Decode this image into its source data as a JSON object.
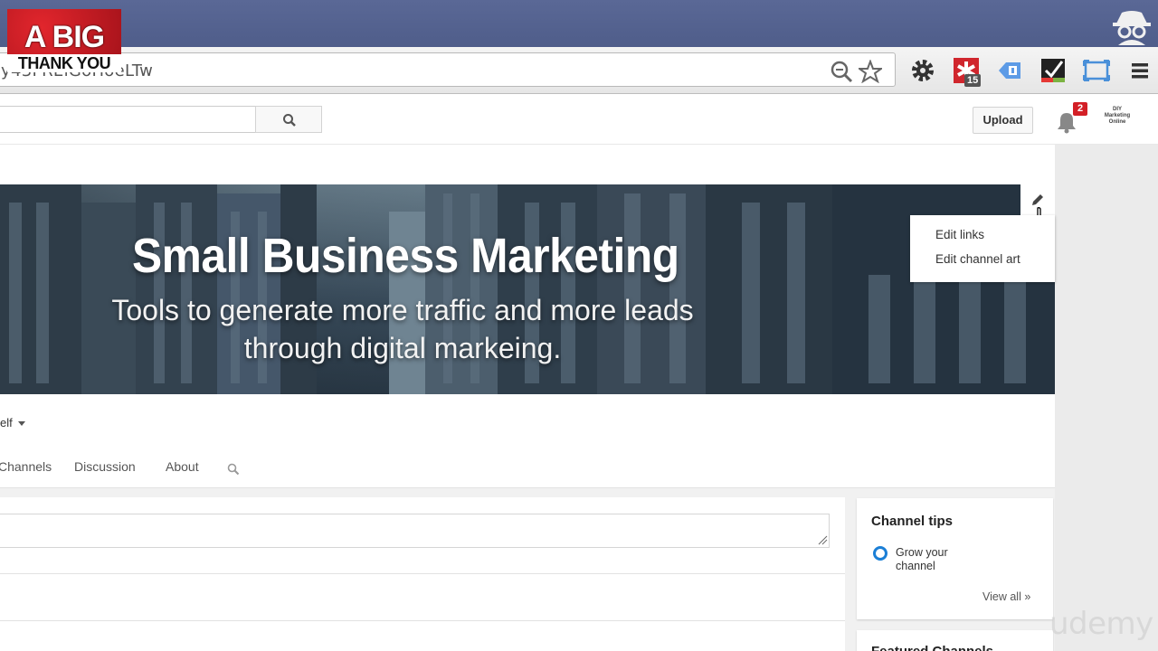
{
  "browser": {
    "url_fragment": "y43FRElGoHoeLTw",
    "extension_badge": "15"
  },
  "overlay": {
    "line1": "A BIG",
    "line2": "THANK YOU"
  },
  "masthead": {
    "search_placeholder": "",
    "upload_label": "Upload",
    "notification_count": "2",
    "avatar_text": "DIY Marketing Online"
  },
  "banner": {
    "title": "Small Business Marketing",
    "subtitle": "Tools to generate more traffic and more leads through digital markeing."
  },
  "edit_menu": {
    "items": [
      "Edit links",
      "Edit channel art"
    ]
  },
  "channel": {
    "subscribe_partial": "elf",
    "tabs": [
      "Channels",
      "Discussion",
      "About"
    ]
  },
  "channel_tips": {
    "title": "Channel tips",
    "tip": "Grow your channel",
    "view_all": "View all »"
  },
  "featured": {
    "title": "Featured Channels"
  },
  "watermark": "udemy",
  "colors": {
    "titlebar": "#5a6896",
    "notification_red": "#d31f26",
    "tip_blue": "#1b7fd6"
  }
}
